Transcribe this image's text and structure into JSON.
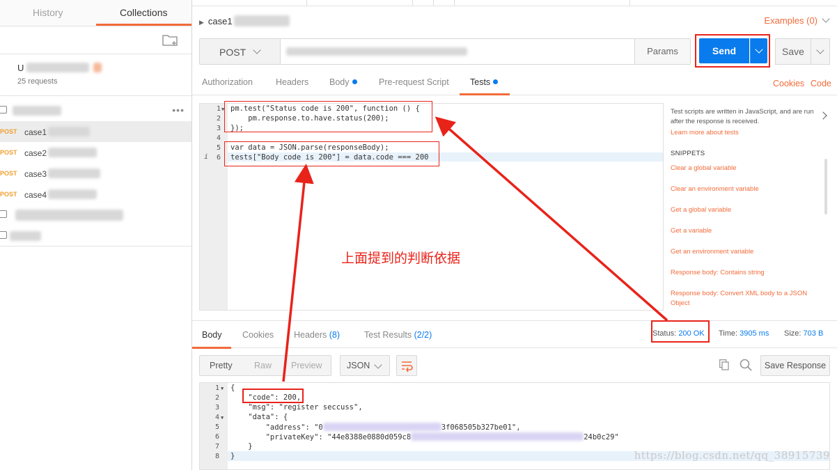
{
  "sidebar": {
    "tabs": [
      {
        "label": "History"
      },
      {
        "label": "Collections"
      }
    ],
    "collection": {
      "name": "U",
      "count": "25 requests"
    },
    "requests": [
      {
        "method": "POST",
        "name": "case1"
      },
      {
        "method": "POST",
        "name": "case2"
      },
      {
        "method": "POST",
        "name": "case3"
      },
      {
        "method": "POST",
        "name": "case4"
      }
    ]
  },
  "header": {
    "breadcrumb": "case1",
    "examples": "Examples (0)"
  },
  "request": {
    "method": "POST",
    "params_label": "Params",
    "send_label": "Send",
    "save_label": "Save",
    "tabs": [
      {
        "label": "Authorization"
      },
      {
        "label": "Headers"
      },
      {
        "label": "Body"
      },
      {
        "label": "Pre-request Script"
      },
      {
        "label": "Tests"
      }
    ],
    "cookies_label": "Cookies",
    "code_label": "Code"
  },
  "tests_editor": {
    "line_numbers": [
      "1",
      "2",
      "3",
      "4",
      "5",
      "6"
    ],
    "lines": [
      "pm.test(\"Status code is 200\", function () {",
      "    pm.response.to.have.status(200);",
      "});",
      "",
      "var data = JSON.parse(responseBody);",
      "tests[\"Body code is 200\"] = data.code === 200"
    ]
  },
  "snippets": {
    "description": "Test scripts are written in JavaScript, and are run after the response is received.",
    "learn_more": "Learn more about tests",
    "title": "SNIPPETS",
    "items": [
      "Clear a global variable",
      "Clear an environment variable",
      "Get a global variable",
      "Get a variable",
      "Get an environment variable",
      "Response body: Contains string",
      "Response body: Convert XML body to a JSON Object"
    ]
  },
  "annotation": {
    "text": "上面提到的判断依据"
  },
  "response": {
    "tabs": [
      {
        "label": "Body"
      },
      {
        "label": "Cookies"
      },
      {
        "label": "Headers",
        "count": "(8)"
      },
      {
        "label": "Test Results",
        "count": "(2/2)"
      }
    ],
    "status_label": "Status:",
    "status_value": "200 OK",
    "time_label": "Time:",
    "time_value": "3905 ms",
    "size_label": "Size:",
    "size_value": "703 B",
    "view_modes": [
      "Pretty",
      "Raw",
      "Preview"
    ],
    "format": "JSON",
    "save_response_label": "Save Response",
    "body_line_numbers": [
      "1",
      "2",
      "3",
      "4",
      "5",
      "6",
      "7",
      "8"
    ],
    "body_lines": [
      "{",
      "    \"code\": 200,",
      "    \"msg\": \"register seccuss\",",
      "    \"data\": {",
      "        \"address\": \"0",
      "        \"privateKey\": \"44e8388e0880d059c8",
      "    }",
      "}"
    ],
    "address_tail": "3f068505b327be01\",",
    "privatekey_tail": "24b0c29\""
  },
  "watermark": "https://blog.csdn.net/qq_38915739",
  "colors": {
    "accent": "#f26b3a",
    "send": "#097bed",
    "annotation": "#e8231a"
  }
}
